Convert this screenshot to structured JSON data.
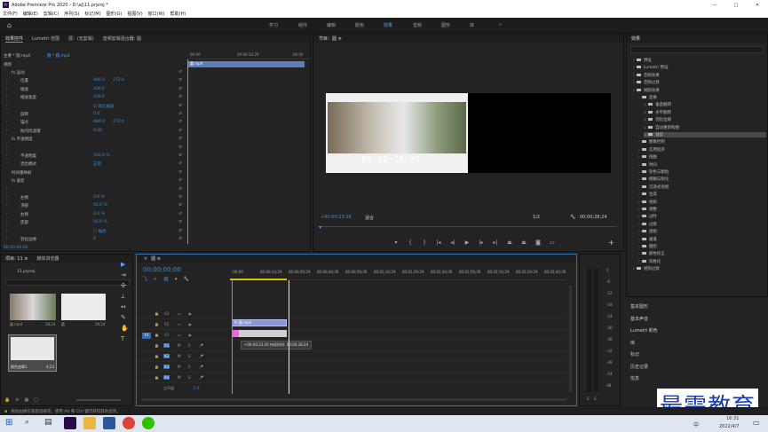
{
  "window": {
    "title": "Adobe Premiere Pro 2020 - D:\\aj\\11.prproj *",
    "min": "—",
    "max": "□",
    "close": "✕"
  },
  "menu": [
    "文件(F)",
    "编辑(E)",
    "剪辑(C)",
    "序列(S)",
    "标记(M)",
    "图形(G)",
    "视图(V)",
    "窗口(W)",
    "帮助(H)"
  ],
  "workspaces": [
    "学习",
    "组件",
    "编辑",
    "颜色",
    "效果",
    "音频",
    "图形",
    "库"
  ],
  "active_workspace": "效果",
  "effect_controls": {
    "tabs": [
      "效果控件",
      "Lumetri 范围",
      "源：(无剪辑)",
      "音频剪辑混合器: 圆"
    ],
    "header_left": "主要 * 圆.mp4",
    "header_right": "圆 * 圆.mp4",
    "ruler": [
      "00:00",
      "00:00:14:29",
      "00:00"
    ],
    "clip_label": "圆.mp4",
    "section_video": "视频",
    "rows": [
      {
        "label": "fx  运动",
        "val1": "",
        "val2": "",
        "indent": 4
      },
      {
        "label": "位置",
        "val1": "480.0",
        "val2": "272.0",
        "indent": 14
      },
      {
        "label": "缩放",
        "val1": "100.0",
        "val2": "",
        "indent": 14
      },
      {
        "label": "缩放宽度",
        "val1": "100.0",
        "val2": "",
        "indent": 14
      },
      {
        "label": "",
        "val1": "☑ 等比缩放",
        "val2": "",
        "indent": 14
      },
      {
        "label": "旋转",
        "val1": "0.0",
        "val2": "",
        "indent": 14
      },
      {
        "label": "锚点",
        "val1": "480.0",
        "val2": "272.0",
        "indent": 14
      },
      {
        "label": "防闪烁滤镜",
        "val1": "0.00",
        "val2": "",
        "indent": 14
      },
      {
        "label": "fx  不透明度",
        "val1": "",
        "val2": "",
        "indent": 4
      },
      {
        "label": "",
        "val1": "",
        "val2": "",
        "indent": 14
      },
      {
        "label": "不透明度",
        "val1": "100.0 %",
        "val2": "",
        "indent": 14
      },
      {
        "label": "混合模式",
        "val1": "正常",
        "val2": "",
        "indent": 14
      },
      {
        "label": "时间重映射",
        "val1": "",
        "val2": "",
        "indent": 4
      },
      {
        "label": "fx  裁剪",
        "val1": "",
        "val2": "",
        "indent": 4
      },
      {
        "label": "",
        "val1": "",
        "val2": "",
        "indent": 14
      },
      {
        "label": "左侧",
        "val1": "0.0 %",
        "val2": "",
        "indent": 14
      },
      {
        "label": "顶部",
        "val1": "50.0 %",
        "val2": "",
        "indent": 14
      },
      {
        "label": "右侧",
        "val1": "0.0 %",
        "val2": "",
        "indent": 14
      },
      {
        "label": "底部",
        "val1": "50.0 %",
        "val2": "",
        "indent": 14
      },
      {
        "label": "",
        "val1": "☐ 缩放",
        "val2": "",
        "indent": 14
      },
      {
        "label": "羽化边缘",
        "val1": "0",
        "val2": "",
        "indent": 14
      }
    ],
    "timecode": "00:00:00:00"
  },
  "program": {
    "title": "节目：圆 ≡",
    "overlay_timecode": "00:00:26:27",
    "current_time": "+00;00;23;26",
    "fit": "适合",
    "quality": "1/2",
    "duration": "00;00;28;24"
  },
  "effects_panel": {
    "title": "效果",
    "items": [
      {
        "label": "预设",
        "level": 0
      },
      {
        "label": "Lumetri 预设",
        "level": 0
      },
      {
        "label": "音频效果",
        "level": 0
      },
      {
        "label": "音频过渡",
        "level": 0
      },
      {
        "label": "视频效果",
        "level": 0
      },
      {
        "label": "变换",
        "level": 1
      },
      {
        "label": "垂直翻转",
        "level": 2
      },
      {
        "label": "水平翻转",
        "level": 2
      },
      {
        "label": "羽化边缘",
        "level": 2
      },
      {
        "label": "自动重新构图",
        "level": 2
      },
      {
        "label": "裁剪",
        "level": 2,
        "selected": true
      },
      {
        "label": "图像控制",
        "level": 1
      },
      {
        "label": "实用程序",
        "level": 1
      },
      {
        "label": "扭曲",
        "level": 1
      },
      {
        "label": "时间",
        "level": 1
      },
      {
        "label": "杂色与颗粒",
        "level": 1
      },
      {
        "label": "模糊与锐化",
        "level": 1
      },
      {
        "label": "沉浸式视频",
        "level": 1
      },
      {
        "label": "生成",
        "level": 1
      },
      {
        "label": "视频",
        "level": 1
      },
      {
        "label": "调整",
        "level": 1
      },
      {
        "label": "过时",
        "level": 1
      },
      {
        "label": "过渡",
        "level": 1
      },
      {
        "label": "透视",
        "level": 1
      },
      {
        "label": "通道",
        "level": 1
      },
      {
        "label": "键控",
        "level": 1
      },
      {
        "label": "颜色校正",
        "level": 1
      },
      {
        "label": "风格化",
        "level": 1
      },
      {
        "label": "视频过渡",
        "level": 0
      }
    ],
    "side_panels": [
      "基本图形",
      "基本声音",
      "Lumetri 颜色",
      "库",
      "标记",
      "历史记录",
      "信息"
    ]
  },
  "project": {
    "tabs": [
      "项目: 11 ≡",
      "媒体浏览器"
    ],
    "file": "11.prproj",
    "items": [
      {
        "name": "圆.mp4",
        "dur": "28;24"
      },
      {
        "name": "圆",
        "dur": "28;24"
      },
      {
        "name": "颜色遮罩1",
        "dur": "4;23"
      }
    ]
  },
  "timeline": {
    "title": "圆 ≡",
    "timecode": "00;00;00;00",
    "ruler": [
      ":00;00",
      "00;00;14;29",
      "00;00;29;29",
      "00;00;44;28",
      "00;00;59;28",
      "00;01;14;29",
      "00;01;29;29",
      "00;01;44;28",
      "00;01;59;28",
      "00;02;14;29",
      "00;02;29;29",
      "00;02;44;28"
    ],
    "video_tracks": [
      "V3",
      "V2",
      "V1"
    ],
    "audio_tracks": [
      "A1",
      "A2",
      "A3",
      "A4"
    ],
    "master": "主声道",
    "master_val": "0.0",
    "clip_label": "fx 圆.mp4",
    "tooltip": "+00;00;23;26 持续时间: 00;00;28;24"
  },
  "meter": {
    "labels": [
      "0",
      "-6",
      "-12",
      "-18",
      "-24",
      "-30",
      "-36",
      "-42",
      "-48",
      "-54",
      "dB"
    ],
    "bottom": [
      "S",
      "S"
    ]
  },
  "status": "拖动边缘可裁剪选择项。使用 Alt 和 Ctrl 键可获得其他选项。",
  "taskbar": {
    "time": "16:31",
    "date": "2022/4/7",
    "lang": "中"
  },
  "watermark": "最需教育"
}
